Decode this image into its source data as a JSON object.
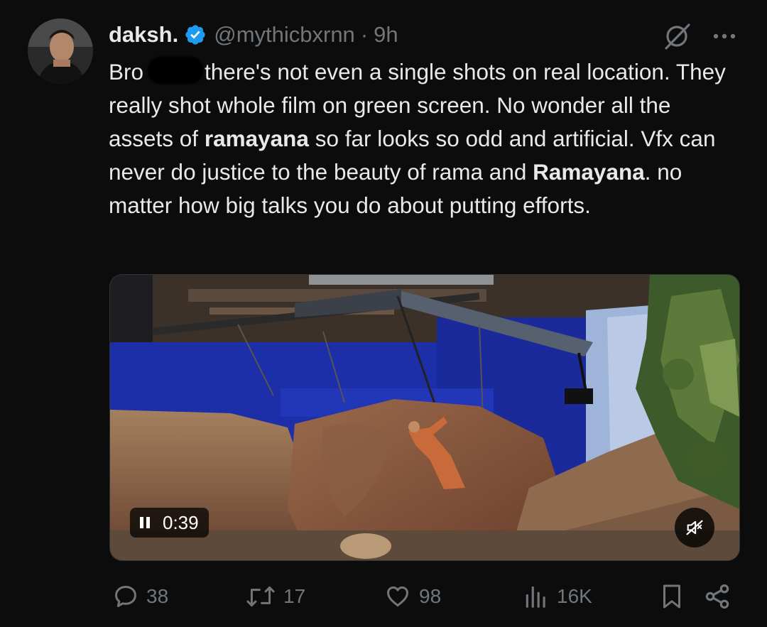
{
  "author": {
    "name": "daksh.",
    "handle": "@mythicbxrnn",
    "separator": "·",
    "time": "9h",
    "verified": true
  },
  "tweet": {
    "segments": [
      {
        "text": "Bro",
        "bold": false
      },
      {
        "redacted": true
      },
      {
        "text": "there's not even a single shots on real location. They really shot whole film on green screen. No wonder all the assets of ",
        "bold": false
      },
      {
        "text": "ramayana",
        "bold": true
      },
      {
        "text": " so far looks so odd and artificial. Vfx can never do justice to the beauty of rama and ",
        "bold": false
      },
      {
        "text": "Ramayana",
        "bold": true
      },
      {
        "text": ". no matter how big talks you do about putting efforts.",
        "bold": false
      }
    ]
  },
  "media": {
    "type": "video",
    "timestamp": "0:39",
    "state": "playing",
    "muted": true
  },
  "actions": {
    "replies": "38",
    "reposts": "17",
    "likes": "98",
    "views": "16K"
  },
  "icons": [
    "verified-badge-icon",
    "grok-icon",
    "more-icon",
    "pause-icon",
    "mute-icon",
    "reply-icon",
    "repost-icon",
    "like-icon",
    "views-icon",
    "bookmark-icon",
    "share-icon"
  ],
  "colors": {
    "background": "#0c0c0c",
    "text": "#e7e9ea",
    "muted": "#71767b",
    "verified": "#1d9bf0",
    "chroma_blue": "#1d2fa8"
  }
}
